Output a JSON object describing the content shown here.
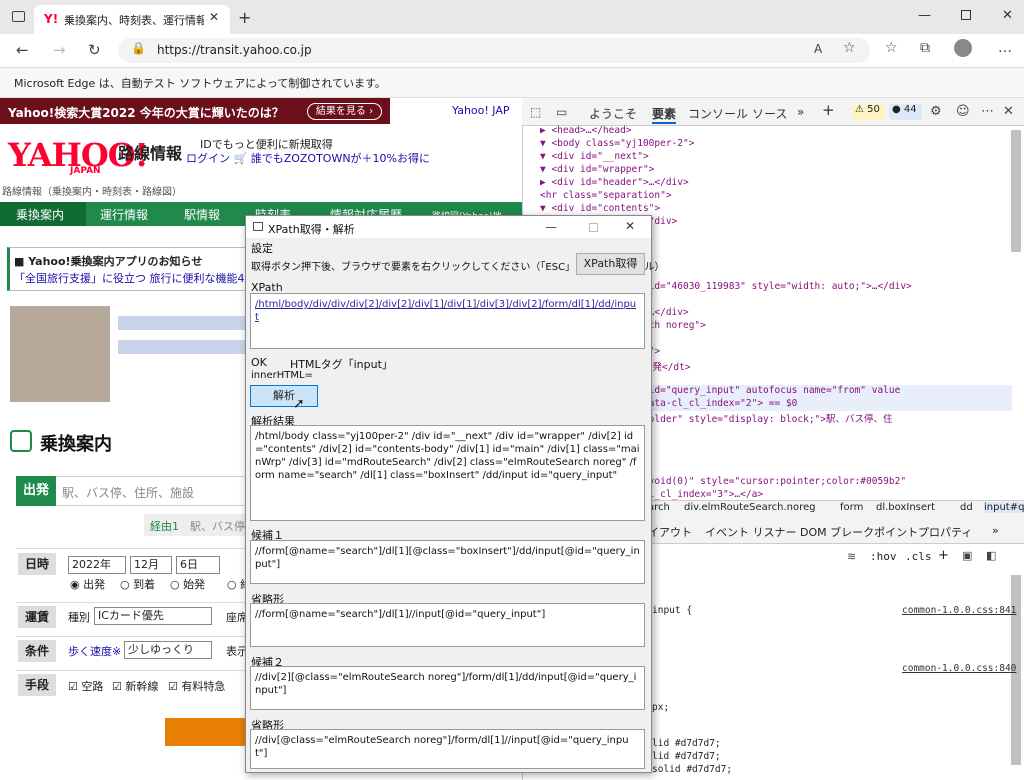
{
  "browser": {
    "tab_title": "乗換案内、時刻表、運行情報 - Yah",
    "url": "https://transit.yahoo.co.jp",
    "automation_notice": "Microsoft Edge は、自動テスト ソフトウェアによって制御されています。"
  },
  "page": {
    "banner": {
      "text": "Yahoo!検索大賞2022 今年の大賞に輝いたのは？",
      "button": "結果を見る ›",
      "yahoo_link": "Yahoo! JAP"
    },
    "logo": {
      "main": "YAHOO!",
      "sub": "JAPAN",
      "title": "路線情報"
    },
    "idline1": "IDでもっと便利に新規取得",
    "idline2": "ログイン 🛒 誰でもZOZOTOWNが＋10%お得に",
    "breadcrumb": "路線情報（乗換案内・時刻表・路線図）",
    "nav": [
      "乗換案内",
      "運行情報",
      "駅情報",
      "時刻表",
      "情報対応履歴",
      "路線図(Yahoo!地"
    ],
    "notice1": "■ Yahoo!乗換案内アプリのお知らせ",
    "notice2": "「全国旅行支援」に役立つ 旅行に便利な機能4選",
    "section": "乗換案内",
    "from_label": "出発",
    "from_placeholder": "駅、バス停、住所、施設",
    "via_label": "経由1",
    "via_placeholder": "駅、バス停",
    "date_label": "日時",
    "year": "2022年",
    "month": "12月",
    "day": "6日",
    "radios": [
      "出発",
      "到着",
      "始発",
      "終"
    ],
    "fare_label": "運賃",
    "fare_kind": "種別",
    "fare_value": "ICカード優先",
    "seat": "座席",
    "cond_label": "条件",
    "speed": "歩く速度※",
    "speed_value": "少しゆっくり",
    "display": "表示",
    "means_label": "手段",
    "means": [
      "空路",
      "新幹線",
      "有料特急"
    ]
  },
  "devtools": {
    "tabs": [
      "ようこそ",
      "要素",
      "コンソール",
      "ソース",
      "»",
      "+"
    ],
    "badges": [
      "50",
      "44"
    ],
    "code": [
      "▶ <head>…</head>",
      "▼ <body class=\"yj100per-2\">",
      "  ▼ <div id=\"__next\">",
      "    ▼ <div id=\"wrapper\">",
      "      ▶ <div id=\"header\">…</div>",
      "        <hr class=\"separation\">",
      "      ▼ <div id=\"contents\">",
      "          contents-header\">…</div>",
      "          contents-body\">",
      "          main\">",
      "          class=\"mainWrp\">",
      "          </div>",
      "          class=\"pos-infeed\" id=\"46030_119983\" style=\"width: auto;\">…</div>",
      "          d=\"mdRouteSearch\">",
      "          class=\"labelLarge\">…</div>",
      "          class=\"elmRouteSearch noreg\">",
      "          orm name=\"search\">",
      "          dl class=\"boxInsert\">",
      "           <dt class=\"label\">出発</dt>",
      "           <dd>",
      "             <input type=\"text\" id=\"query_input\" autofocus name=\"from\" value",
      "             autocomplete=\"on\" data-cl_cl_index=\"2\"> == $0",
      "             <span class=\"placeholder\" style=\"display: block;\">駅、バス停、住",
      "             所、施設</span>",
      "           </dd>",
      "          /dl>",
      "           ::after",
      "          a href=\"javascript:void(0)\" style=\"cursor:pointer;color:#0059b2\"",
      "          abindex=\"-1\" data-cl_cl_index=\"3\">…</a>"
    ],
    "crumbs": [
      "arch",
      "div.elmRouteSearch.noreg",
      "form",
      "dl.boxInsert",
      "dd",
      "input#query_input"
    ],
    "subtabs": [
      "イアウト",
      "イベント リスナー",
      "DOM ブレークポイント",
      "プロパティ",
      "»"
    ],
    "filter_tools": [
      ":hov",
      ".cls",
      "+"
    ],
    "styles": [
      {
        "text": "input {",
        "link": "common-1.0.0.css:841"
      },
      {
        "text": "",
        "link": "common-1.0.0.css:840"
      },
      {
        "text": "px;",
        "link": ""
      },
      {
        "text": "lid #d7d7d7;",
        "link": ""
      },
      {
        "text": "lid #d7d7d7;",
        "link": ""
      },
      {
        "text": "solid #d7d7d7;",
        "link": ""
      }
    ]
  },
  "dialog": {
    "title": "XPath取得・解析",
    "settings": "設定",
    "instruction": "取得ボタン押下後、ブラウザで要素を右クリックしてください（「ESC」キーでキャンセル）",
    "get_button": "XPath取得",
    "xpath_label": "XPath",
    "xpath_value": "/html/body/div/div/div[2]/div[2]/div[1]/div[1]/div[3]/div[2]/form/dl[1]/dd/input",
    "ok": "OK",
    "tag": "HTMLタグ「input」",
    "inner": "innerHTML=",
    "analyze_button": "解析",
    "result_label": "解析結果",
    "result_value": "/html/body class=\"yj100per-2\" /div id=\"__next\" /div id=\"wrapper\" /div[2] id=\"contents\" /div[2] id=\"contents-body\" /div[1] id=\"main\" /div[1] class=\"mainWrp\" /div[3] id=\"mdRouteSearch\" /div[2] class=\"elmRouteSearch noreg\" /form name=\"search\" /dl[1] class=\"boxInsert\" /dd/input id=\"query_input\"",
    "cand1_label": "候補１",
    "cand1_value": "//form[@name=\"search\"]/dl[1][@class=\"boxInsert\"]/dd/input[@id=\"query_input\"]",
    "abbr1_label": "省略形",
    "abbr1_value": "//form[@name=\"search\"]/dl[1]//input[@id=\"query_input\"]",
    "cand2_label": "候補２",
    "cand2_value": "//div[2][@class=\"elmRouteSearch noreg\"]/form/dl[1]/dd/input[@id=\"query_input\"]",
    "abbr2_label": "省略形",
    "abbr2_value": "//div[@class=\"elmRouteSearch noreg\"]/form/dl[1]//input[@id=\"query_input\"]"
  }
}
